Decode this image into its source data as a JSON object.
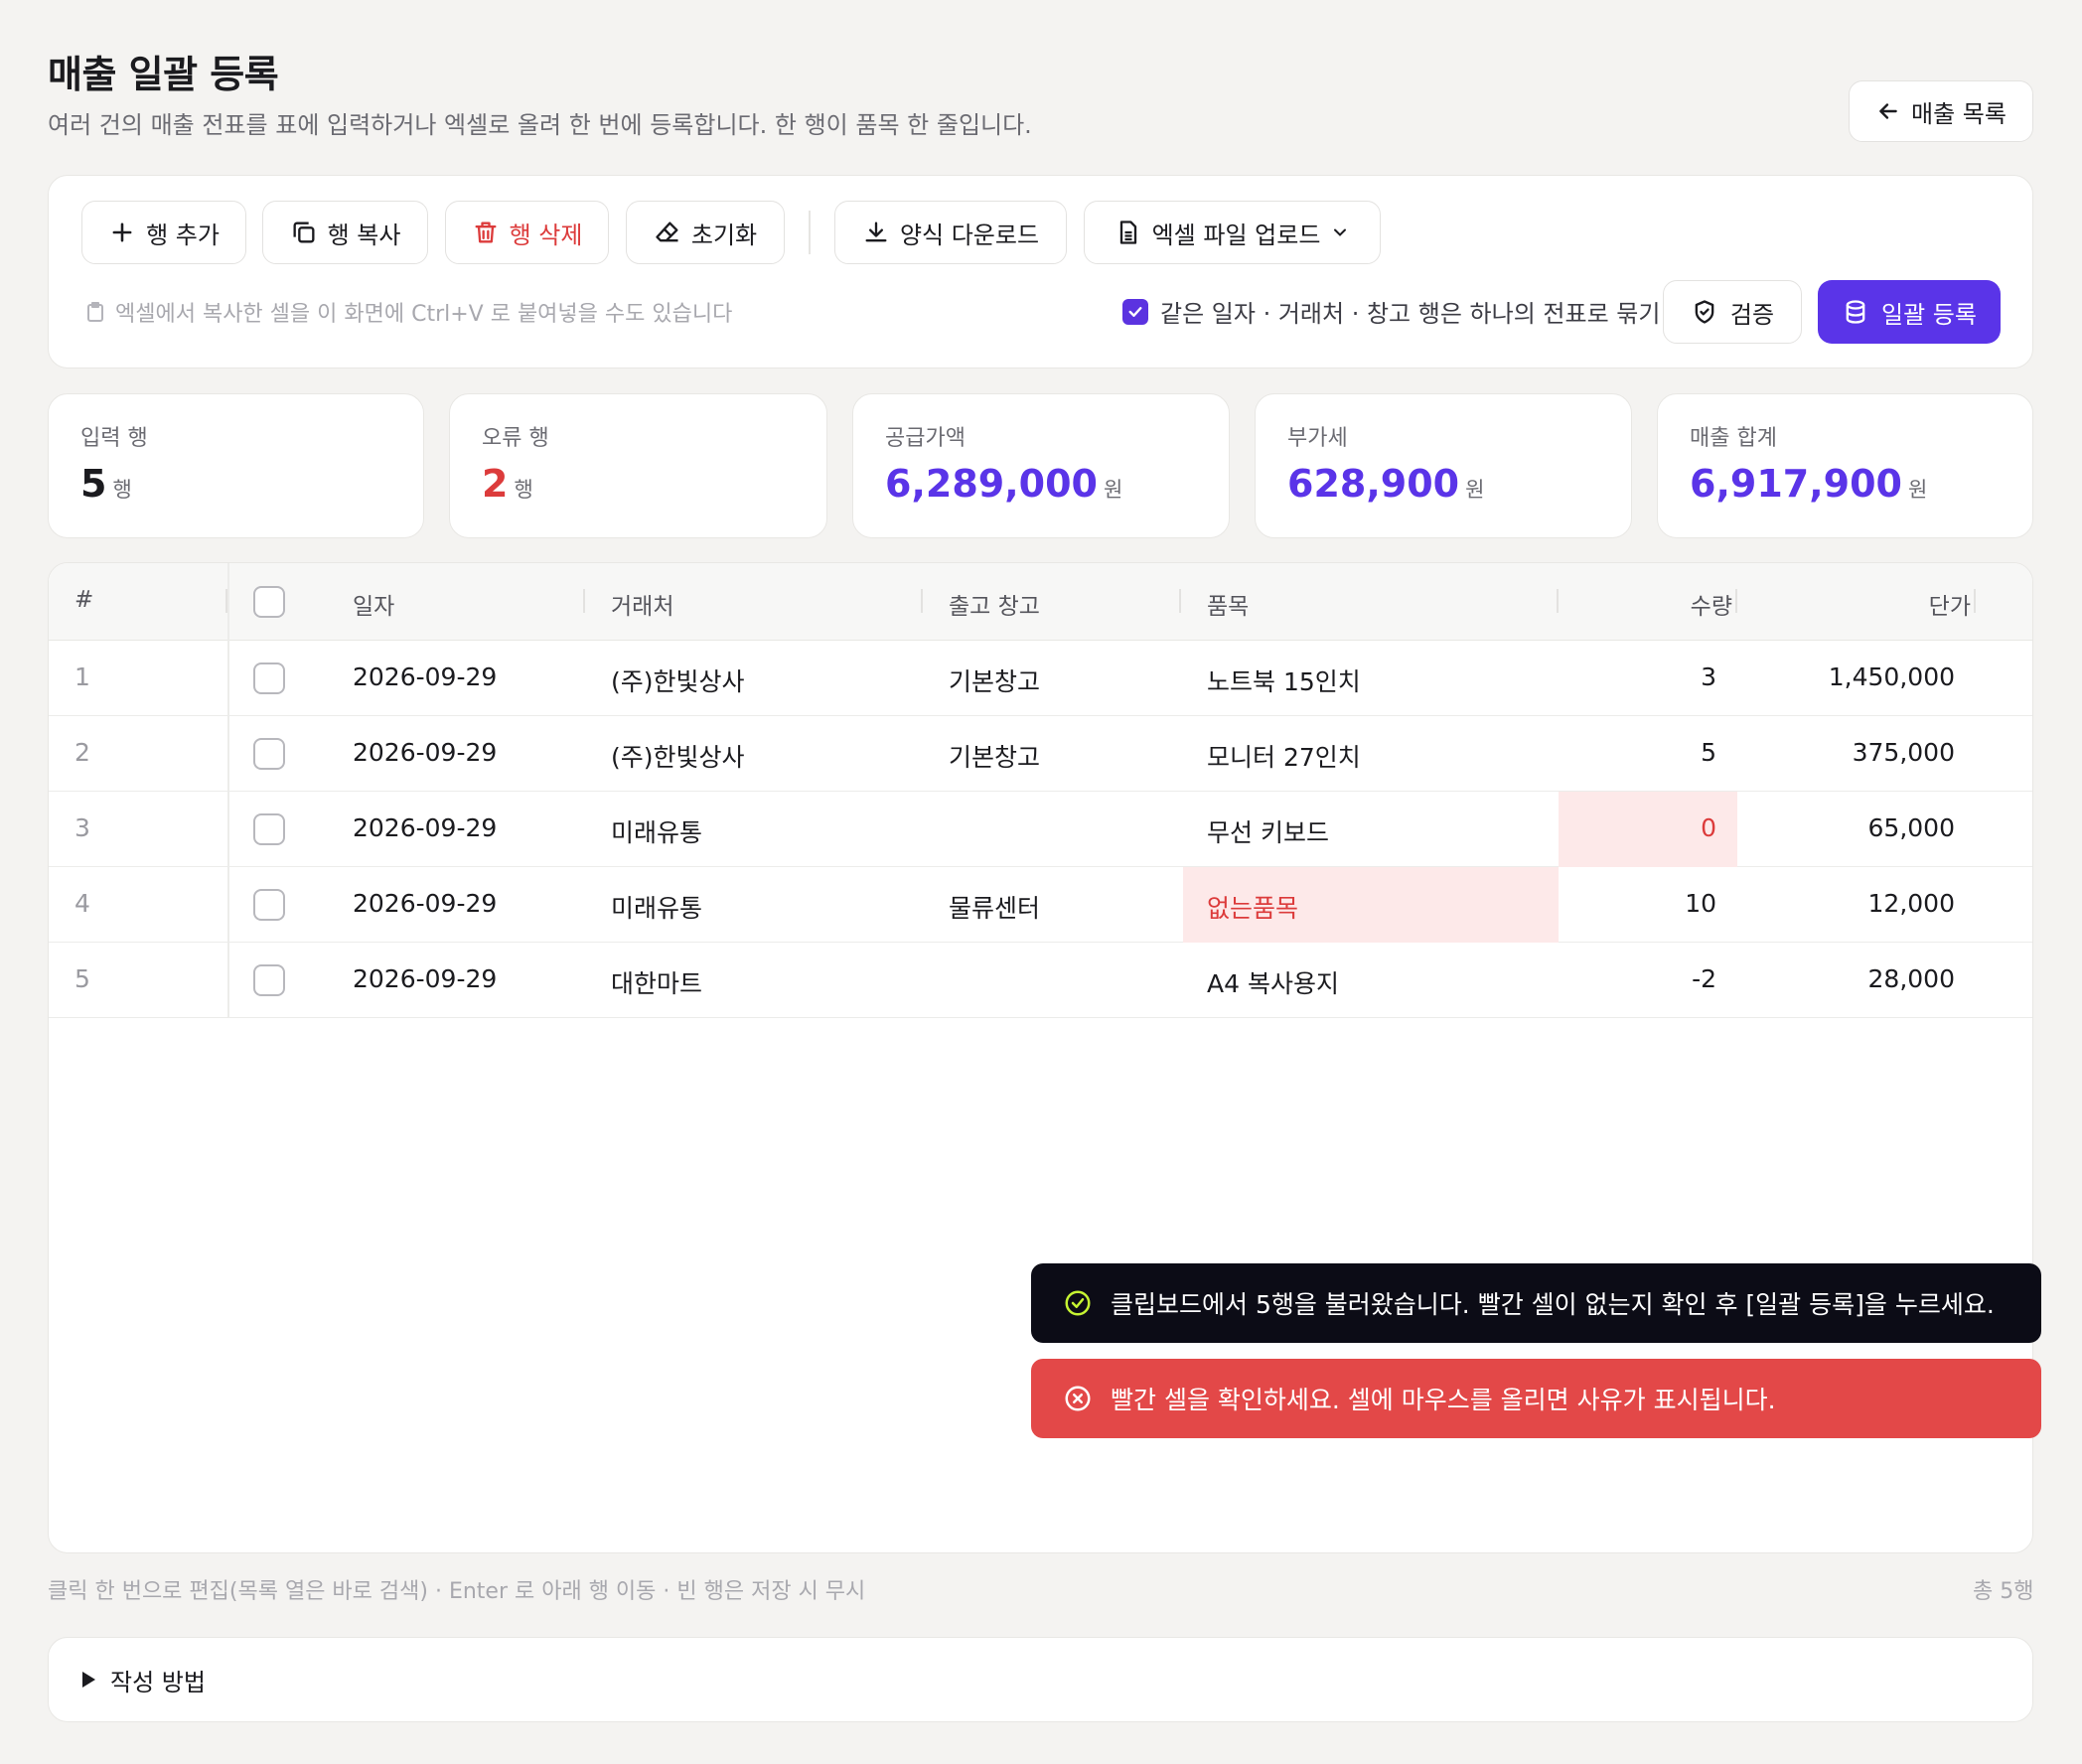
{
  "header": {
    "title": "매출 일괄 등록",
    "subtitle": "여러 건의 매출 전표를 표에 입력하거나 엑셀로 올려 한 번에 등록합니다. 한 행이 품목 한 줄입니다.",
    "back_label": "매출 목록"
  },
  "toolbar": {
    "add_row": "행 추가",
    "copy_row": "행 복사",
    "delete_row": "행 삭제",
    "reset": "초기화",
    "template_download": "양식 다운로드",
    "excel_upload": "엑셀 파일 업로드",
    "paste_hint": "엑셀에서 복사한 셀을 이 화면에 Ctrl+V 로 붙여넣을 수도 있습니다",
    "group_option": "같은 일자 · 거래처 · 창고 행은 하나의 전표로 묶기",
    "group_checked": true,
    "verify": "검증",
    "submit": "일괄 등록"
  },
  "stats": [
    {
      "label": "입력 행",
      "value": "5",
      "unit": "행"
    },
    {
      "label": "오류 행",
      "value": "2",
      "unit": "행"
    },
    {
      "label": "공급가액",
      "value": "6,289,000",
      "unit": "원"
    },
    {
      "label": "부가세",
      "value": "628,900",
      "unit": "원"
    },
    {
      "label": "매출 합계",
      "value": "6,917,900",
      "unit": "원"
    }
  ],
  "table": {
    "headers": {
      "idx": "#",
      "date": "일자",
      "customer": "거래처",
      "warehouse": "출고 창고",
      "item": "품목",
      "qty": "수량",
      "price": "단가"
    },
    "rows": [
      {
        "idx": "1",
        "date": "2026-09-29",
        "customer": "(주)한빛상사",
        "warehouse": "기본창고",
        "item": "노트북 15인치",
        "qty": "3",
        "price": "1,450,000",
        "error": ""
      },
      {
        "idx": "2",
        "date": "2026-09-29",
        "customer": "(주)한빛상사",
        "warehouse": "기본창고",
        "item": "모니터 27인치",
        "qty": "5",
        "price": "375,000",
        "error": ""
      },
      {
        "idx": "3",
        "date": "2026-09-29",
        "customer": "미래유통",
        "warehouse": "",
        "item": "무선 키보드",
        "qty": "0",
        "price": "65,000",
        "error": "qty"
      },
      {
        "idx": "4",
        "date": "2026-09-29",
        "customer": "미래유통",
        "warehouse": "물류센터",
        "item": "없는품목",
        "qty": "10",
        "price": "12,000",
        "error": "item"
      },
      {
        "idx": "5",
        "date": "2026-09-29",
        "customer": "대한마트",
        "warehouse": "",
        "item": "A4 복사용지",
        "qty": "-2",
        "price": "28,000",
        "error": ""
      }
    ]
  },
  "toasts": {
    "success": "클립보드에서 5행을 불러왔습니다. 빨간 셀이 없는지 확인 후 [일괄 등록]을 누르세요.",
    "error": "빨간 셀을 확인하세요. 셀에 마우스를 올리면 사유가 표시됩니다."
  },
  "footer": {
    "hint": "클릭 한 번으로 편집(목록 열은 바로 검색) · Enter 로 아래 행 이동 · 빈 행은 저장 시 무시",
    "count": "총 5행",
    "howto": "작성 방법"
  },
  "colors": {
    "accent": "#5a34e8",
    "error": "#dc3b3b",
    "error_bg": "#fde9e9",
    "toast_dark": "#0c0c16",
    "toast_error": "#e34848"
  }
}
